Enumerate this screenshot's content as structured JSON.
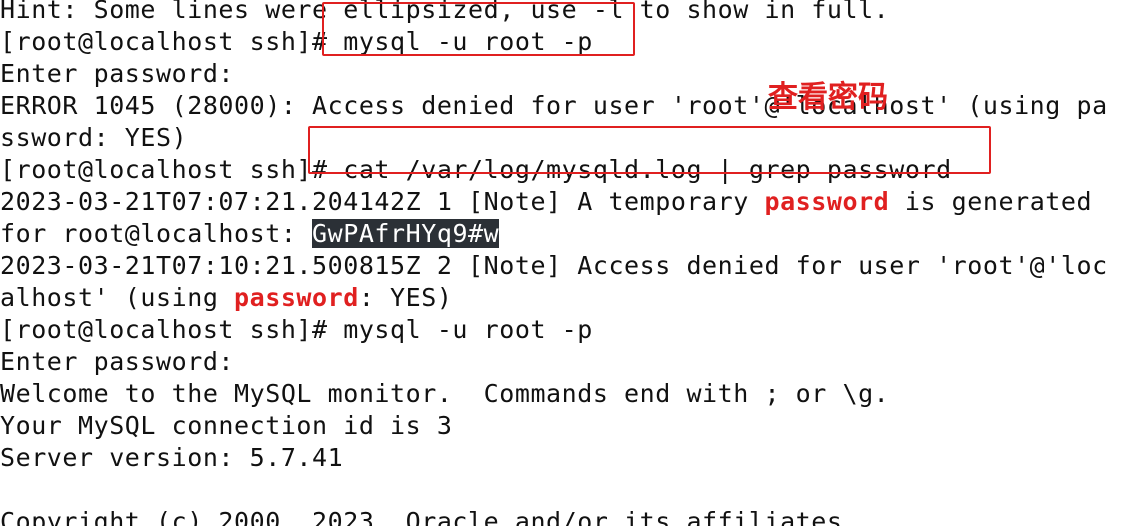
{
  "terminal": {
    "lines": [
      {
        "text": "Hint: Some lines were ellipsized, use -l to show in full."
      },
      {
        "text": "[root@localhost ssh]# mysql -u root -p"
      },
      {
        "text": "Enter password:"
      },
      {
        "text": "ERROR 1045 (28000): Access denied for user 'root'@'localhost' (using pa"
      },
      {
        "text": "ssword: YES)"
      },
      {
        "text": "[root@localhost ssh]# cat /var/log/mysqld.log | grep password"
      },
      {
        "pre": "2023-03-21T07:07:21.204142Z 1 [Note] A temporary ",
        "hl": "password",
        "post": " is generated"
      },
      {
        "pre": "for root@localhost: ",
        "sel": "GwPAfrHYq9#w"
      },
      {
        "text": "2023-03-21T07:10:21.500815Z 2 [Note] Access denied for user 'root'@'loc"
      },
      {
        "pre": "alhost' (using ",
        "hl": "password",
        "post": ": YES)"
      },
      {
        "text": "[root@localhost ssh]# mysql -u root -p"
      },
      {
        "text": "Enter password:"
      },
      {
        "text": "Welcome to the MySQL monitor.  Commands end with ; or \\g."
      },
      {
        "text": "Your MySQL connection id is 3"
      },
      {
        "text": "Server version: 5.7.41"
      },
      {
        "text": ""
      },
      {
        "text": "Copyright (c) 2000, 2023, Oracle and/or its affiliates."
      }
    ]
  },
  "annotation": {
    "label": "查看密码",
    "color": "#e02020"
  },
  "colors": {
    "background": "#ffffff",
    "text": "#111111",
    "highlight": "#e02020",
    "selection_bg": "#2b3036"
  }
}
